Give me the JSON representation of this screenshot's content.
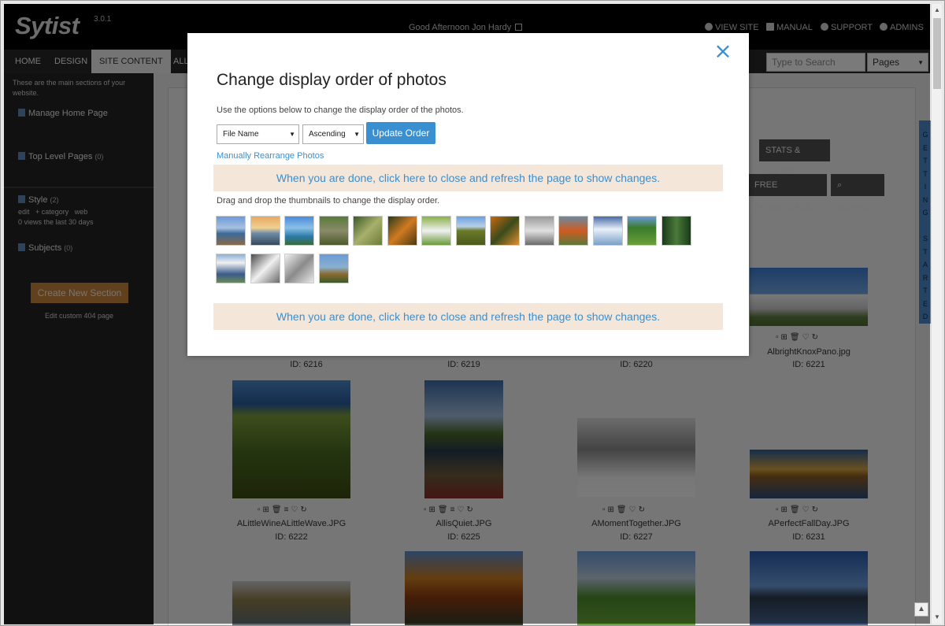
{
  "app": {
    "logo": "Sytist",
    "version": "3.0.1",
    "greeting": "Good Afternoon Jon Hardy"
  },
  "toplinks": [
    {
      "label": "VIEW SITE",
      "icon": "globe-icon"
    },
    {
      "label": "MANUAL",
      "icon": "book-icon"
    },
    {
      "label": "SUPPORT",
      "icon": "support-icon"
    },
    {
      "label": "ADMINS",
      "icon": "user-icon"
    }
  ],
  "nav": {
    "tabs": [
      "HOME",
      "DESIGN",
      "SITE CONTENT",
      "ALL"
    ],
    "active": "SITE CONTENT",
    "search_placeholder": "Type to Search",
    "pages_select": "Pages"
  },
  "sidebar": {
    "intro": "These are the main sections of your website.",
    "items": [
      {
        "label": "Manage Home Page",
        "count": ""
      },
      {
        "label": "Top Level Pages",
        "count": "(0)"
      },
      {
        "label": "Style",
        "count": "(2)"
      },
      {
        "label": "Subjects",
        "count": "(0)"
      }
    ],
    "style_links": "edit   + category   web",
    "style_views": "0 views the last 30 days",
    "create_button": "Create New Section",
    "edit_404": "Edit custom 404 page"
  },
  "content": {
    "buttons": [
      "STATS & SALES",
      "FREE DOWNLOADS",
      "SEARCH"
    ],
    "right_tab_letters": [
      "G",
      "E",
      "T",
      "T",
      "I",
      "N",
      "G",
      "",
      "S",
      "T",
      "A",
      "R",
      "T",
      "E",
      "D"
    ],
    "photos": [
      {
        "name": "",
        "id": "ID: 6216"
      },
      {
        "name": "",
        "id": "ID: 6219"
      },
      {
        "name": "",
        "id": "ID: 6220"
      },
      {
        "name": "AlbrightKnoxPano.jpg",
        "id": "ID: 6221"
      },
      {
        "name": "ALittleWineALittleWave.JPG",
        "id": "ID: 6222"
      },
      {
        "name": "AllisQuiet.JPG",
        "id": "ID: 6225"
      },
      {
        "name": "AMomentTogether.JPG",
        "id": "ID: 6227"
      },
      {
        "name": "APerfectFallDay.JPG",
        "id": "ID: 6231"
      }
    ]
  },
  "modal": {
    "title": "Change display order of photos",
    "description": "Use the options below to change the display order of the photos.",
    "sort_field": "File Name",
    "sort_direction": "Ascending",
    "update_button": "Update Order",
    "manual_link": "Manually Rearrange Photos",
    "done_text": "When you are done, click here to close and refresh the page to show changes.",
    "drag_text": "Drag and drop the thumbnails to change the display order.",
    "thumbnails": [
      "dock-lake",
      "sunset-lake",
      "blue-water",
      "fountain",
      "autumn-leaves",
      "orange-leaves",
      "bird-field",
      "vineyard",
      "fall-foliage",
      "snow-tree",
      "orange-flowers",
      "waterfall",
      "green-path",
      "forest",
      "white-gazebo",
      "snowy-woods",
      "snow-branches",
      "autumn-tower"
    ]
  }
}
